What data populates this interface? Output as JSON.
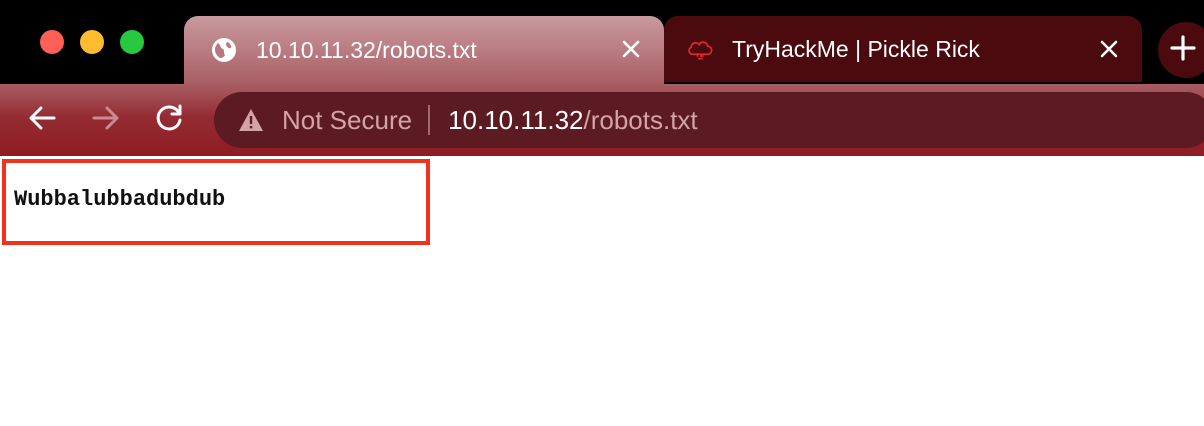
{
  "window": {
    "traffic_lights": [
      "close",
      "minimize",
      "zoom"
    ]
  },
  "tabs": [
    {
      "title": "10.10.11.32/robots.txt",
      "favicon": "globe-icon",
      "active": true
    },
    {
      "title": "TryHackMe | Pickle Rick",
      "favicon": "tryhackme-cloud-icon",
      "active": false
    }
  ],
  "toolbar": {
    "back_icon": "arrow-left-icon",
    "forward_icon": "arrow-right-icon",
    "reload_icon": "reload-icon",
    "new_tab_icon": "plus-icon"
  },
  "address_bar": {
    "security_label": "Not Secure",
    "security_icon": "warning-triangle-icon",
    "host": "10.10.11.32",
    "path": "/robots.txt"
  },
  "page": {
    "content_text": "Wubbalubbadubdub"
  },
  "colors": {
    "tab_active": "#b8797e",
    "tab_inactive": "#4a0a0e",
    "toolbar": "#952c33",
    "omnibox": "#5c1a22",
    "highlight_border": "#f1321e"
  }
}
